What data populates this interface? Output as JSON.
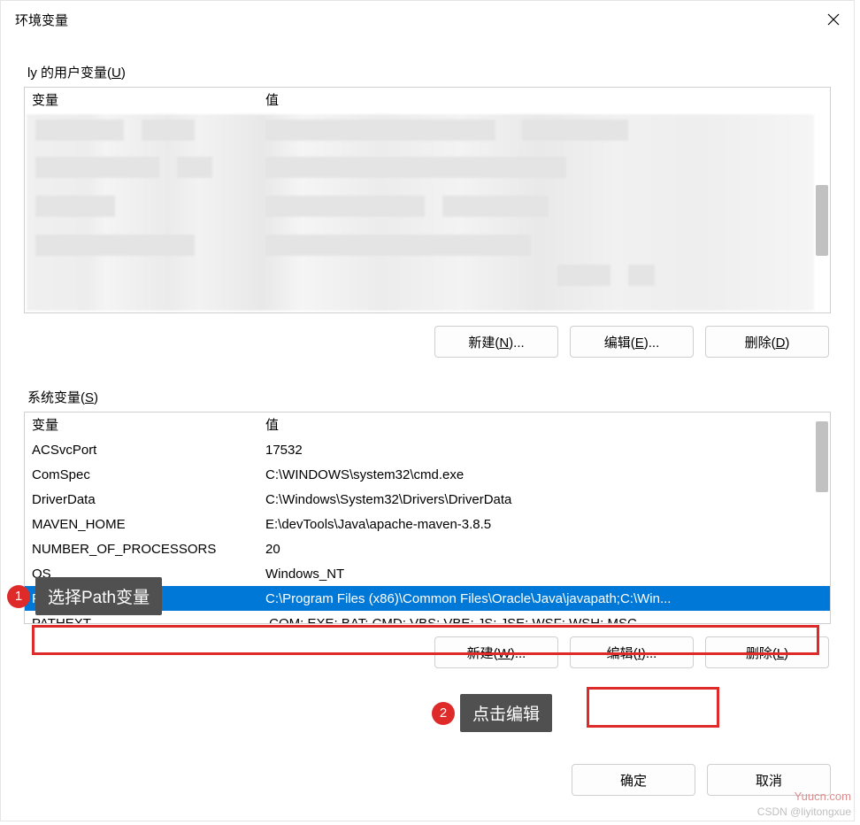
{
  "dialog": {
    "title": "环境变量"
  },
  "user_section": {
    "label_prefix": "ly 的用户变量(",
    "label_u": "U",
    "label_suffix": ")",
    "col_var": "变量",
    "col_val": "值"
  },
  "sys_section": {
    "label_prefix": "系统变量(",
    "label_s": "S",
    "label_suffix": ")",
    "col_var": "变量",
    "col_val": "值",
    "rows": [
      {
        "var": "ACSvcPort",
        "val": "17532"
      },
      {
        "var": "ComSpec",
        "val": "C:\\WINDOWS\\system32\\cmd.exe"
      },
      {
        "var": "DriverData",
        "val": "C:\\Windows\\System32\\Drivers\\DriverData"
      },
      {
        "var": "MAVEN_HOME",
        "val": "E:\\devTools\\Java\\apache-maven-3.8.5"
      },
      {
        "var": "NUMBER_OF_PROCESSORS",
        "val": "20"
      },
      {
        "var": "OS",
        "val": "Windows_NT"
      },
      {
        "var": "Path",
        "val": "C:\\Program Files (x86)\\Common Files\\Oracle\\Java\\javapath;C:\\Win..."
      },
      {
        "var": "PATHEXT",
        "val": ".COM;.EXE;.BAT;.CMD;.VBS;.VBE;.JS;.JSE;.WSF;.WSH;.MSC"
      }
    ],
    "selected_index": 6
  },
  "buttons": {
    "user_new": "新建(N)...",
    "user_edit": "编辑(E)...",
    "user_del": "删除(D)",
    "sys_new": "新建(W)...",
    "sys_edit": "编辑(I)...",
    "sys_del": "删除(L)",
    "ok": "确定",
    "cancel": "取消"
  },
  "annotations": {
    "a1_num": "1",
    "a1_text": "选择Path变量",
    "a2_num": "2",
    "a2_text": "点击编辑"
  },
  "watermark": {
    "site": "Yuucn.com",
    "attr": "CSDN @liyitongxue"
  }
}
